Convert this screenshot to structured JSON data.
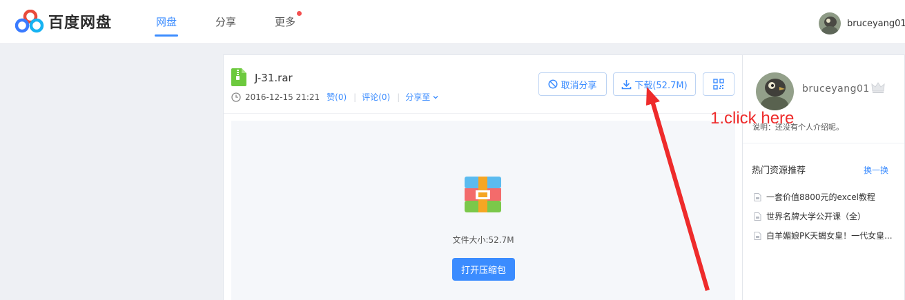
{
  "header": {
    "logo_text": "百度网盘",
    "nav": [
      {
        "label": "网盘",
        "active": true
      },
      {
        "label": "分享",
        "active": false
      },
      {
        "label": "更多",
        "active": false,
        "has_badge_dot": true
      }
    ],
    "user_name": "bruceyang01"
  },
  "file": {
    "name": "J-31.rar",
    "date": "2016-12-15 21:21",
    "like_label": "赞(0)",
    "comment_label": "评论(0)",
    "share_to_label": "分享至",
    "cancel_share_label": "取消分享",
    "download_label": "下载(52.7M)",
    "size_text": "文件大小:52.7M",
    "open_archive_label": "打开压缩包"
  },
  "sidebar": {
    "user_name": "bruceyang01",
    "intro": "说明：还没有个人介绍呢。",
    "hot_title": "热门资源推荐",
    "refresh_label": "换一换",
    "hot_items": [
      "一套价值8800元的excel教程",
      "世界名牌大学公开课（全）",
      "白羊媚娘PK天蝎女皇！一代女皇..."
    ]
  },
  "annotation": {
    "text": "1.click here",
    "color": "#ee2b2b"
  },
  "colors": {
    "accent": "#3b8cff",
    "badge_dot": "#f45050",
    "file_green": "#6cc93d"
  },
  "icons": {
    "logo": "baidu-cloud-logo-icon",
    "file": "archive-file-icon",
    "clock": "clock-icon",
    "cancel": "cancel-circle-icon",
    "download": "download-icon",
    "qr": "qr-code-icon",
    "crown": "crown-icon",
    "document": "document-icon"
  }
}
